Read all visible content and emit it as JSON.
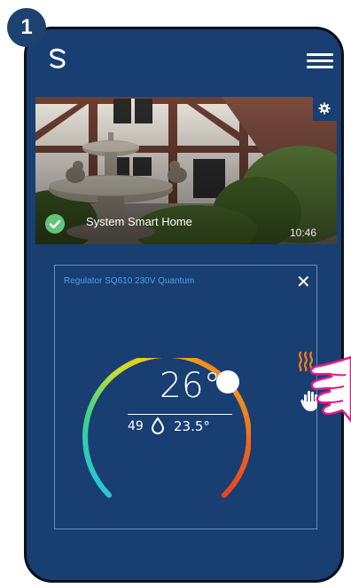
{
  "step": {
    "number": "1"
  },
  "header": {
    "logo_icon": "app-logo-swirl-icon",
    "menu_icon": "hamburger-menu-icon"
  },
  "home": {
    "name": "System Smart Home",
    "time": "10:46",
    "status_icon": "check-icon",
    "settings_icon": "gear-icon"
  },
  "device": {
    "title": "Regulator SQ610 230V Quantum",
    "close_icon": "close-icon",
    "current_temp": "26°",
    "humidity": "49",
    "set_temp": "23.5°",
    "heating_icon": "heating-waves-icon",
    "manual_icon": "hand-icon"
  },
  "colors": {
    "background": "#183e72",
    "accent": "#45a5e8",
    "heating": "#f07b1e",
    "check": "#66c27a"
  }
}
